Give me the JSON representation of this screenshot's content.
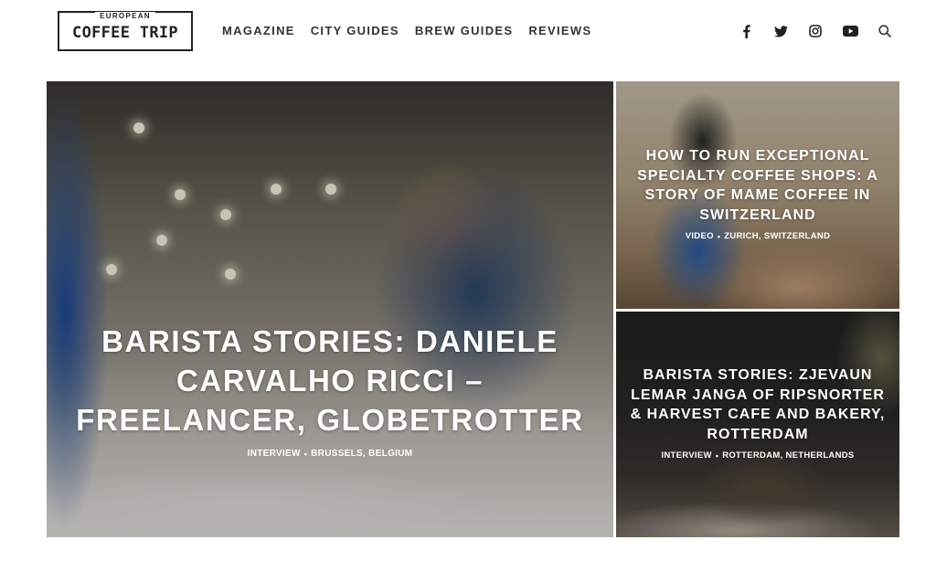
{
  "logo": {
    "top_text": "EUROPEAN",
    "main_text": "COFFEE TRIP"
  },
  "nav": {
    "items": [
      {
        "label": "MAGAZINE"
      },
      {
        "label": "CITY GUIDES"
      },
      {
        "label": "BREW GUIDES"
      },
      {
        "label": "REVIEWS"
      }
    ]
  },
  "social_icons": [
    "facebook-icon",
    "twitter-icon",
    "instagram-icon",
    "youtube-icon",
    "search-icon"
  ],
  "featured": {
    "main": {
      "title": "BARISTA STORIES: DANIELE CARVALHO RICCI – FREELANCER, GLOBETROTTER",
      "category": "INTERVIEW",
      "separator": "•",
      "location": "BRUSSELS, BELGIUM"
    },
    "side_top": {
      "title": "HOW TO RUN EXCEPTIONAL SPECIALTY COFFEE SHOPS: A STORY OF MAME COFFEE IN SWITZERLAND",
      "category": "VIDEO",
      "separator": "•",
      "location": "ZURICH, SWITZERLAND"
    },
    "side_bottom": {
      "title": "BARISTA STORIES: ZJEVAUN LEMAR JANGA OF RIPSNORTER & HARVEST CAFE AND BAKERY, ROTTERDAM",
      "category": "INTERVIEW",
      "separator": "•",
      "location": "ROTTERDAM, NETHERLANDS"
    }
  },
  "colors": {
    "text_dark": "#333333",
    "overlay_text": "#ffffff",
    "background": "#ffffff"
  }
}
